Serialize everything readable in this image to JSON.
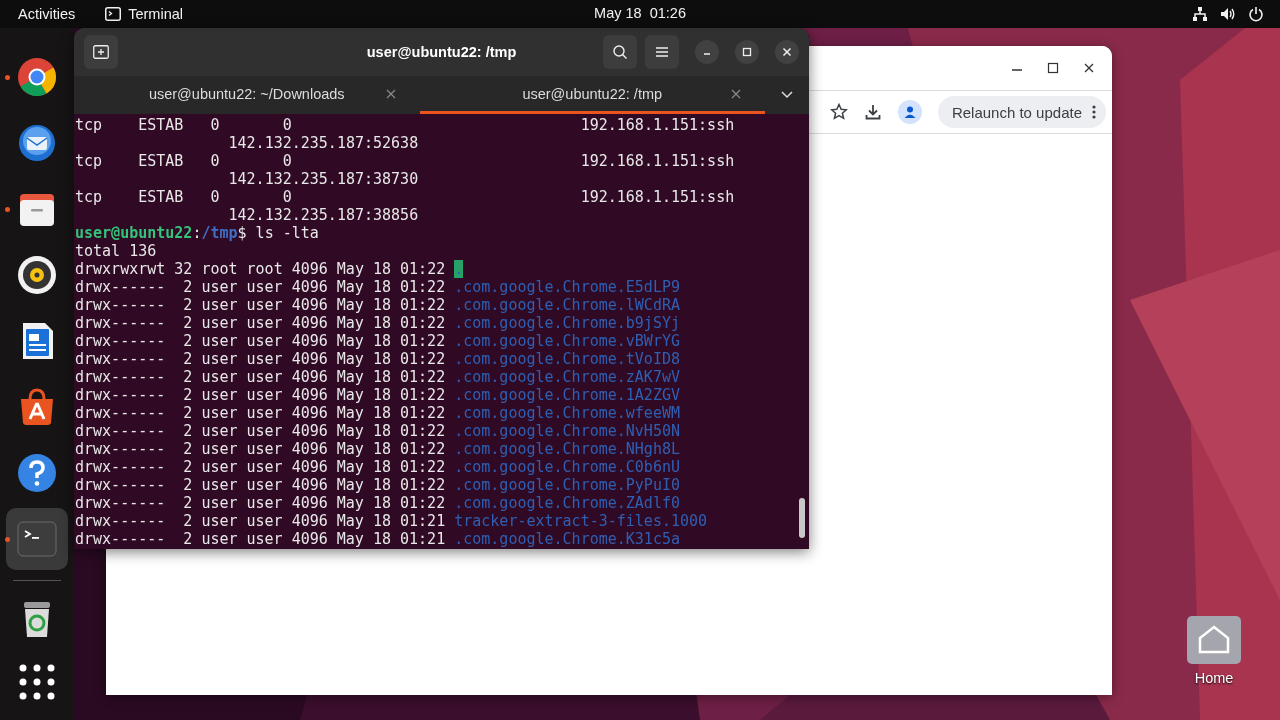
{
  "top_bar": {
    "activities": "Activities",
    "app_name": "Terminal",
    "clock": "May 18  01:26"
  },
  "dock": {
    "items": [
      {
        "kind": "chrome",
        "running": true,
        "active": false
      },
      {
        "kind": "mail",
        "running": false,
        "active": false
      },
      {
        "kind": "files",
        "running": true,
        "active": false
      },
      {
        "kind": "music",
        "running": false,
        "active": false
      },
      {
        "kind": "writer",
        "running": false,
        "active": false
      },
      {
        "kind": "store",
        "running": false,
        "active": false
      },
      {
        "kind": "help",
        "running": false,
        "active": false
      },
      {
        "kind": "terminal",
        "running": true,
        "active": true
      },
      {
        "kind": "trash",
        "running": false,
        "active": false
      },
      {
        "kind": "apps",
        "running": false,
        "active": false
      }
    ]
  },
  "browser_window": {
    "relaunch_button": "Relaunch to update"
  },
  "terminal": {
    "title": "user@ubuntu22: /tmp",
    "tabs": [
      {
        "label": "user@ubuntu22: ~/Downloads",
        "selected": false
      },
      {
        "label": "user@ubuntu22: /tmp",
        "selected": true
      }
    ],
    "socket_rows": [
      {
        "netid": "tcp",
        "state": "ESTAB",
        "recv_q": "0",
        "send_q": "0",
        "local": "192.168.1.151:ssh",
        "peer": "142.132.235.187:52638"
      },
      {
        "netid": "tcp",
        "state": "ESTAB",
        "recv_q": "0",
        "send_q": "0",
        "local": "192.168.1.151:ssh",
        "peer": "142.132.235.187:38730"
      },
      {
        "netid": "tcp",
        "state": "ESTAB",
        "recv_q": "0",
        "send_q": "0",
        "local": "192.168.1.151:ssh",
        "peer": "142.132.235.187:38856"
      }
    ],
    "prompt": {
      "user_host": "user@ubuntu22",
      "separator": ":",
      "path": "/tmp",
      "command": "$ ls -lta"
    },
    "total": "total 136",
    "listing": [
      {
        "mode": "drwxrwxrwt",
        "links": "32",
        "owner": "root",
        "group": "root",
        "size": "4096",
        "date": "May 18 01:22",
        "name": ".",
        "kind": "sticky"
      },
      {
        "mode": "drwx------",
        "links": "2",
        "owner": "user",
        "group": "user",
        "size": "4096",
        "date": "May 18 01:22",
        "name": ".com.google.Chrome.E5dLP9",
        "kind": "dir"
      },
      {
        "mode": "drwx------",
        "links": "2",
        "owner": "user",
        "group": "user",
        "size": "4096",
        "date": "May 18 01:22",
        "name": ".com.google.Chrome.lWCdRA",
        "kind": "dir"
      },
      {
        "mode": "drwx------",
        "links": "2",
        "owner": "user",
        "group": "user",
        "size": "4096",
        "date": "May 18 01:22",
        "name": ".com.google.Chrome.b9jSYj",
        "kind": "dir"
      },
      {
        "mode": "drwx------",
        "links": "2",
        "owner": "user",
        "group": "user",
        "size": "4096",
        "date": "May 18 01:22",
        "name": ".com.google.Chrome.vBWrYG",
        "kind": "dir"
      },
      {
        "mode": "drwx------",
        "links": "2",
        "owner": "user",
        "group": "user",
        "size": "4096",
        "date": "May 18 01:22",
        "name": ".com.google.Chrome.tVoID8",
        "kind": "dir"
      },
      {
        "mode": "drwx------",
        "links": "2",
        "owner": "user",
        "group": "user",
        "size": "4096",
        "date": "May 18 01:22",
        "name": ".com.google.Chrome.zAK7wV",
        "kind": "dir"
      },
      {
        "mode": "drwx------",
        "links": "2",
        "owner": "user",
        "group": "user",
        "size": "4096",
        "date": "May 18 01:22",
        "name": ".com.google.Chrome.1A2ZGV",
        "kind": "dir"
      },
      {
        "mode": "drwx------",
        "links": "2",
        "owner": "user",
        "group": "user",
        "size": "4096",
        "date": "May 18 01:22",
        "name": ".com.google.Chrome.wfeeWM",
        "kind": "dir"
      },
      {
        "mode": "drwx------",
        "links": "2",
        "owner": "user",
        "group": "user",
        "size": "4096",
        "date": "May 18 01:22",
        "name": ".com.google.Chrome.NvH50N",
        "kind": "dir"
      },
      {
        "mode": "drwx------",
        "links": "2",
        "owner": "user",
        "group": "user",
        "size": "4096",
        "date": "May 18 01:22",
        "name": ".com.google.Chrome.NHgh8L",
        "kind": "dir"
      },
      {
        "mode": "drwx------",
        "links": "2",
        "owner": "user",
        "group": "user",
        "size": "4096",
        "date": "May 18 01:22",
        "name": ".com.google.Chrome.C0b6nU",
        "kind": "dir"
      },
      {
        "mode": "drwx------",
        "links": "2",
        "owner": "user",
        "group": "user",
        "size": "4096",
        "date": "May 18 01:22",
        "name": ".com.google.Chrome.PyPuI0",
        "kind": "dir"
      },
      {
        "mode": "drwx------",
        "links": "2",
        "owner": "user",
        "group": "user",
        "size": "4096",
        "date": "May 18 01:22",
        "name": ".com.google.Chrome.ZAdlf0",
        "kind": "dir"
      },
      {
        "mode": "drwx------",
        "links": "2",
        "owner": "user",
        "group": "user",
        "size": "4096",
        "date": "May 18 01:21",
        "name": "tracker-extract-3-files.1000",
        "kind": "dir"
      },
      {
        "mode": "drwx------",
        "links": "2",
        "owner": "user",
        "group": "user",
        "size": "4096",
        "date": "May 18 01:21",
        "name": ".com.google.Chrome.K31c5a",
        "kind": "dir"
      }
    ]
  },
  "desktop_icons": [
    {
      "label": "Home"
    }
  ]
}
